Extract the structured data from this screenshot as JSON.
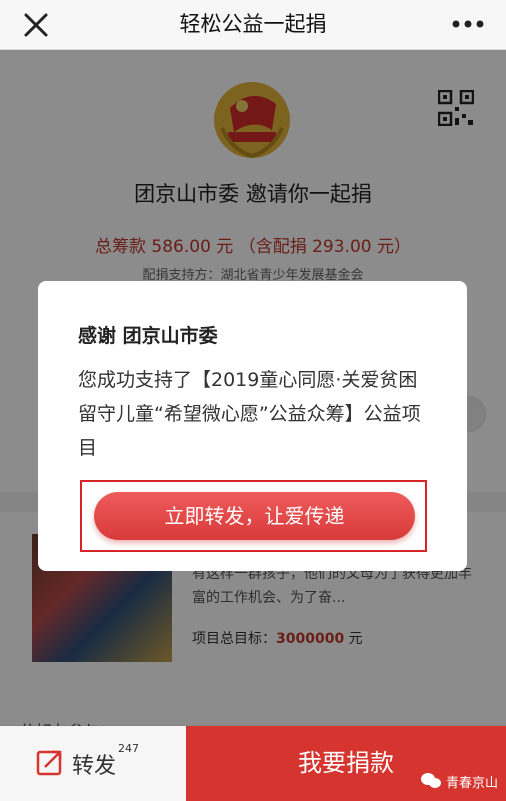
{
  "navbar": {
    "title": "轻松公益一起捐",
    "close_icon": "close-icon",
    "more_icon": "more-icon"
  },
  "page": {
    "invite_text": "团京山市委 邀请你一起捐",
    "total_text": "总筹款 586.00 元 （含配捐 293.00 元）",
    "sponsor_text": "配捐支持方：湖北省青少年发展基金会",
    "project": {
      "description": "有这样一群孩子，他们的父母为了获得更加丰富的工作机会、为了奋...",
      "goal_label": "项目总目标：",
      "goal_value": "3000000",
      "goal_unit": " 元"
    },
    "friends_text": "位好友参与"
  },
  "modal": {
    "title": "感谢 团京山市委",
    "body": "您成功支持了【2019童心同愿·关爱贫困留守儿童“希望微心愿”公益众筹】公益项目",
    "share_button": "立即转发，让爱传递"
  },
  "bottombar": {
    "forward_label": "转发",
    "forward_count": "247",
    "donate_label": "我要捐款"
  },
  "watermark": {
    "text": "青春京山"
  },
  "colors": {
    "accent_red": "#d6352f",
    "amount_red": "#c0392b"
  }
}
